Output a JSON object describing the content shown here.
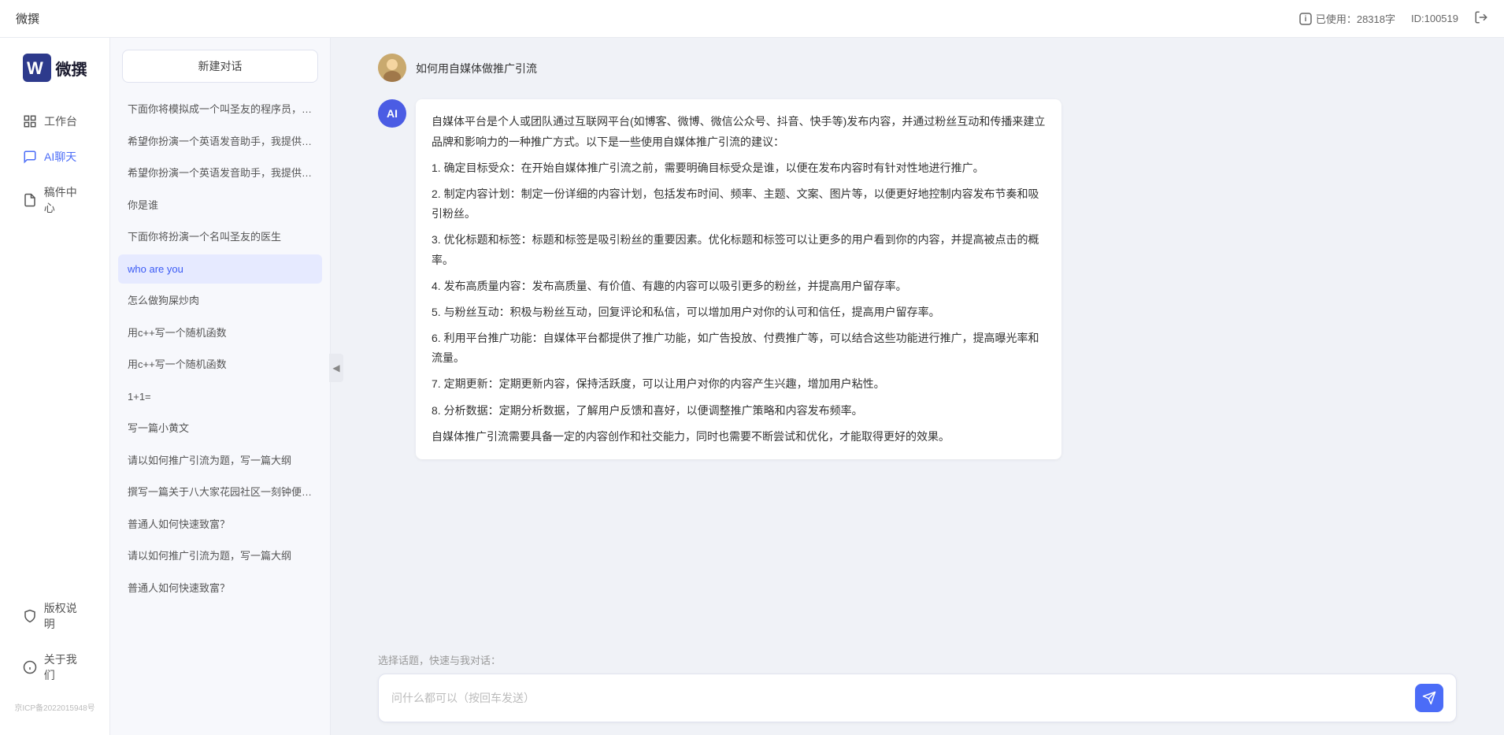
{
  "topbar": {
    "title": "微撰",
    "usage_label": "已使用：28318字",
    "id_label": "ID:100519",
    "usage_icon": "info-icon"
  },
  "sidebar": {
    "logo_text": "微撰",
    "nav_items": [
      {
        "id": "workbench",
        "label": "工作台",
        "icon": "grid-icon",
        "active": false
      },
      {
        "id": "ai-chat",
        "label": "AI聊天",
        "icon": "chat-icon",
        "active": true
      },
      {
        "id": "inbox",
        "label": "稿件中心",
        "icon": "file-icon",
        "active": false
      }
    ],
    "bottom_items": [
      {
        "id": "copyright",
        "label": "版权说明",
        "icon": "shield-icon"
      },
      {
        "id": "about",
        "label": "关于我们",
        "icon": "info-circle-icon"
      }
    ],
    "icp": "京ICP备2022015948号"
  },
  "chat_sidebar": {
    "new_chat_label": "新建对话",
    "history_items": [
      {
        "id": 1,
        "label": "下面你将模拟成一个叫圣友的程序员，我说..."
      },
      {
        "id": 2,
        "label": "希望你扮演一个英语发音助手，我提供给你..."
      },
      {
        "id": 3,
        "label": "希望你扮演一个英语发音助手，我提供给你..."
      },
      {
        "id": 4,
        "label": "你是谁"
      },
      {
        "id": 5,
        "label": "下面你将扮演一个名叫圣友的医生"
      },
      {
        "id": 6,
        "label": "who are you",
        "active": true
      },
      {
        "id": 7,
        "label": "怎么做狗屎炒肉"
      },
      {
        "id": 8,
        "label": "用c++写一个随机函数"
      },
      {
        "id": 9,
        "label": "用c++写一个随机函数"
      },
      {
        "id": 10,
        "label": "1+1="
      },
      {
        "id": 11,
        "label": "写一篇小黄文"
      },
      {
        "id": 12,
        "label": "请以如何推广引流为题，写一篇大纲"
      },
      {
        "id": 13,
        "label": "撰写一篇关于八大家花园社区一刻钟便民生..."
      },
      {
        "id": 14,
        "label": "普通人如何快速致富？"
      },
      {
        "id": 15,
        "label": "请以如何推广引流为题，写一篇大纲"
      },
      {
        "id": 16,
        "label": "普通人如何快速致富？"
      }
    ]
  },
  "chat": {
    "user_message": "如何用自媒体做推广引流",
    "ai_response": {
      "paragraphs": [
        "自媒体平台是个人或团队通过互联网平台(如博客、微博、微信公众号、抖音、快手等)发布内容，并通过粉丝互动和传播来建立品牌和影响力的一种推广方式。以下是一些使用自媒体推广引流的建议：",
        "1. 确定目标受众：在开始自媒体推广引流之前，需要明确目标受众是谁，以便在发布内容时有针对性地进行推广。",
        "2. 制定内容计划：制定一份详细的内容计划，包括发布时间、频率、主题、文案、图片等，以便更好地控制内容发布节奏和吸引粉丝。",
        "3. 优化标题和标签：标题和标签是吸引粉丝的重要因素。优化标题和标签可以让更多的用户看到你的内容，并提高被点击的概率。",
        "4. 发布高质量内容：发布高质量、有价值、有趣的内容可以吸引更多的粉丝，并提高用户留存率。",
        "5. 与粉丝互动：积极与粉丝互动，回复评论和私信，可以增加用户对你的认可和信任，提高用户留存率。",
        "6. 利用平台推广功能：自媒体平台都提供了推广功能，如广告投放、付费推广等，可以结合这些功能进行推广，提高曝光率和流量。",
        "7. 定期更新：定期更新内容，保持活跃度，可以让用户对你的内容产生兴趣，增加用户粘性。",
        "8. 分析数据：定期分析数据，了解用户反馈和喜好，以便调整推广策略和内容发布频率。",
        "自媒体推广引流需要具备一定的内容创作和社交能力，同时也需要不断尝试和优化，才能取得更好的效果。"
      ]
    },
    "quick_topics_label": "选择话题，快速与我对话：",
    "input_placeholder": "问什么都可以（按回车发送）"
  }
}
